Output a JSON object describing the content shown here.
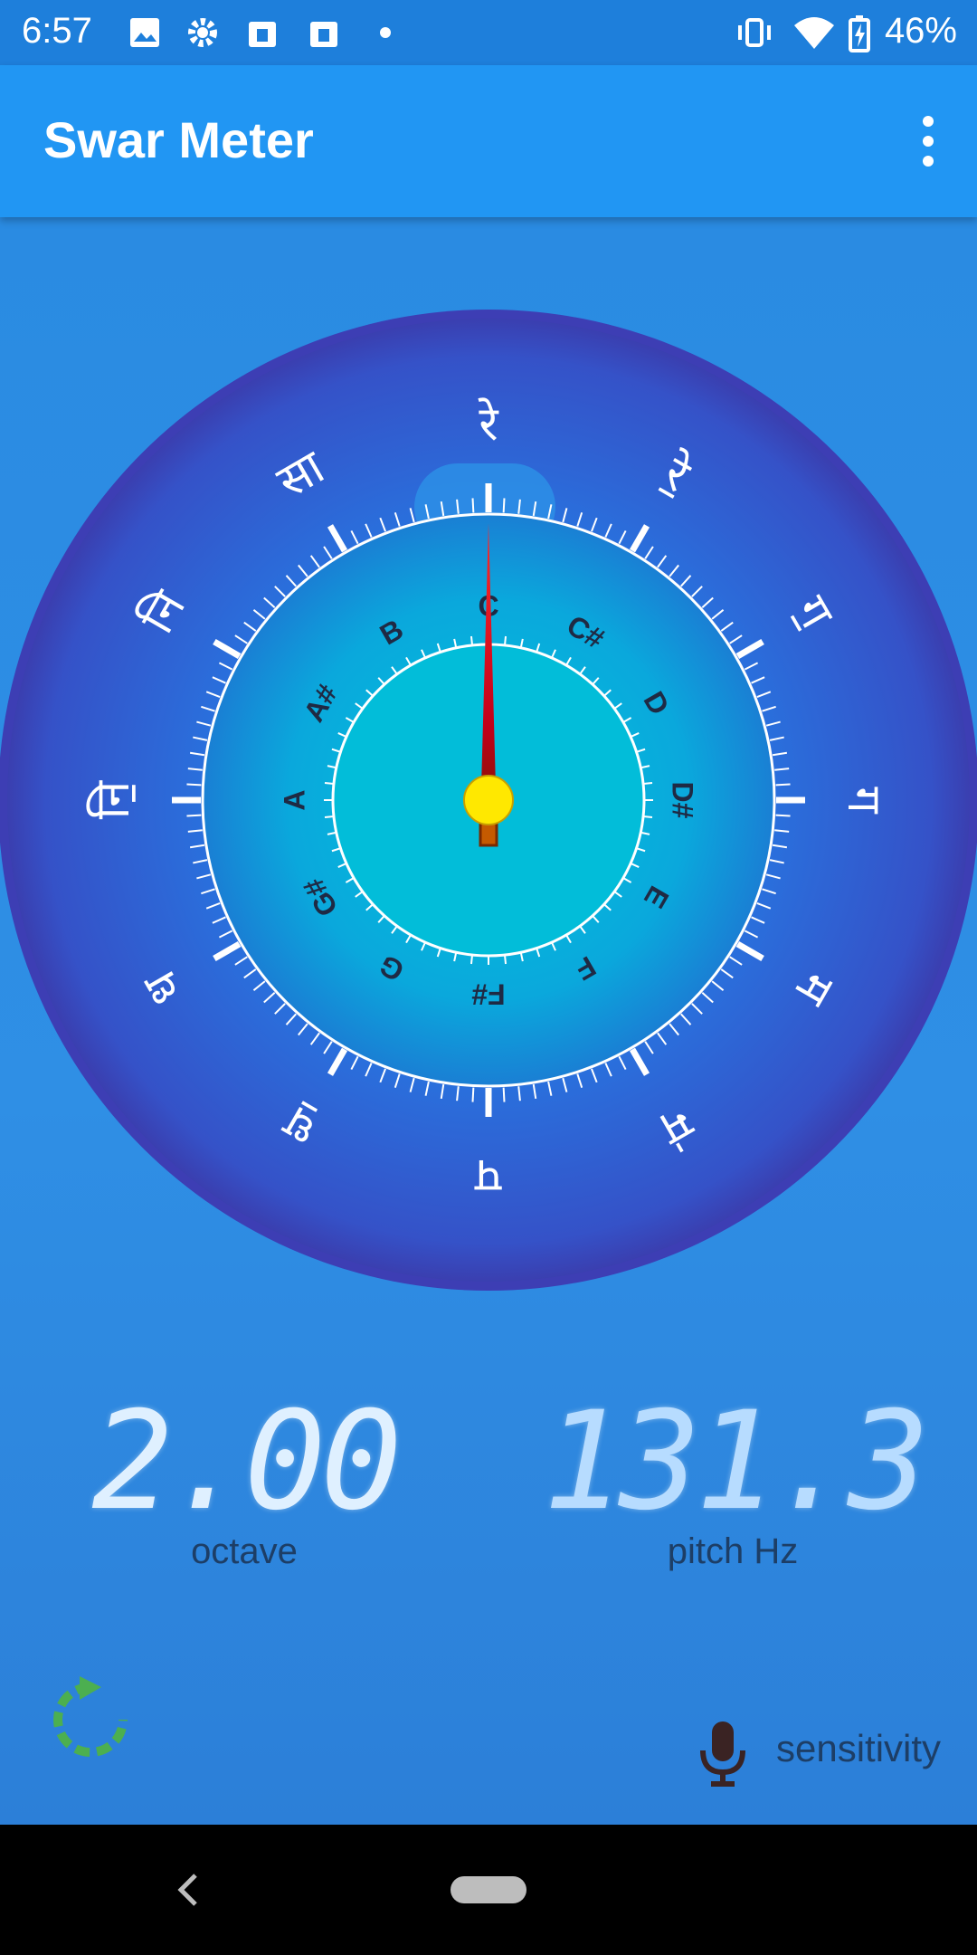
{
  "status_bar": {
    "time": "6:57",
    "battery": "46%"
  },
  "app_bar": {
    "title": "Swar Meter"
  },
  "dial": {
    "hindi_notes": [
      "रे",
      "रे॒",
      "ग॒",
      "ग",
      "म",
      "म॑",
      "प",
      "ध॒",
      "ध",
      "नि॒",
      "नि",
      "सा"
    ],
    "selected_index": 0,
    "western_notes": [
      "C",
      "C#",
      "D",
      "D#",
      "E",
      "F",
      "F#",
      "G",
      "G#",
      "A",
      "A#",
      "B"
    ],
    "needle_note_index": 0,
    "colors": {
      "outer_ring": "#3a4fc7",
      "inner_face": "#0fb0dc",
      "needle": "#c0001a",
      "hub": "#ffe800"
    }
  },
  "readouts": {
    "octave": {
      "value": "2.00",
      "label": "octave"
    },
    "pitch": {
      "value": "131.3",
      "label": "pitch Hz"
    }
  },
  "bottom": {
    "sensitivity_label": "sensitivity",
    "refresh_icon_color": "#4caf50"
  }
}
